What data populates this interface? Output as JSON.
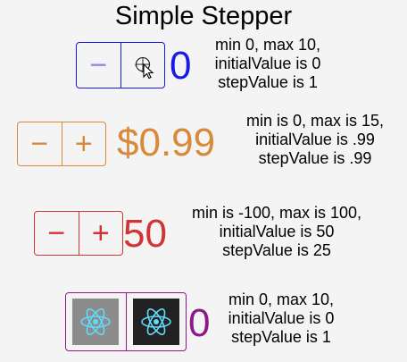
{
  "title": "Simple Stepper",
  "steppers": [
    {
      "minus": "−",
      "plus": "+",
      "value": "0",
      "color": "#1a1ae6",
      "desc": [
        "min 0, max 10,",
        "initialValue is 0",
        "stepValue is 1"
      ]
    },
    {
      "minus": "−",
      "plus": "+",
      "value": "$0.99",
      "color": "#d9893a",
      "desc": [
        "min is 0, max is 15,",
        "initialValue is .99",
        "stepValue is .99"
      ]
    },
    {
      "minus": "−",
      "plus": "+",
      "value": "50",
      "color": "#d23333",
      "desc": [
        "min is -100, max is 100,",
        "initialValue is 50",
        "stepValue is 25"
      ]
    },
    {
      "minus_icon": "react-logo-icon",
      "plus_icon": "react-logo-icon",
      "value": "0",
      "color": "#8a1a8a",
      "desc": [
        "min 0, max 10,",
        "initialValue is 0",
        "stepValue is 1"
      ]
    }
  ]
}
